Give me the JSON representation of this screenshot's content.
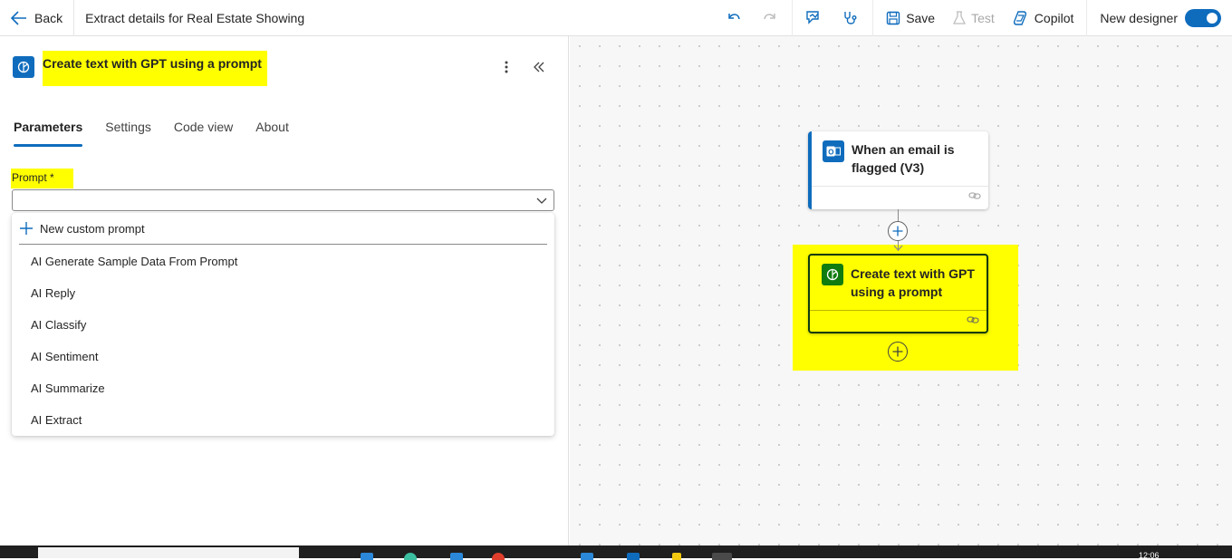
{
  "topbar": {
    "back_label": "Back",
    "flow_title": "Extract details for Real Estate Showing",
    "save_label": "Save",
    "test_label": "Test",
    "copilot_label": "Copilot",
    "new_designer_label": "New designer",
    "new_designer_on": true
  },
  "panel": {
    "title": "Create text with GPT using a prompt",
    "tabs": [
      {
        "label": "Parameters",
        "active": true
      },
      {
        "label": "Settings",
        "active": false
      },
      {
        "label": "Code view",
        "active": false
      },
      {
        "label": "About",
        "active": false
      }
    ],
    "prompt_label": "Prompt *",
    "prompt_value": "",
    "dropdown": {
      "new_label": "New custom prompt",
      "items": [
        "AI Generate Sample Data From Prompt",
        "AI Reply",
        "AI Classify",
        "AI Sentiment",
        "AI Summarize",
        "AI Extract"
      ]
    }
  },
  "canvas": {
    "nodes": [
      {
        "title": "When an email is flagged (V3)",
        "icon": "outlook-icon",
        "color": "#0f6cbd"
      },
      {
        "title": "Create text with GPT using a prompt",
        "icon": "ai-builder-icon",
        "color": "#107c10"
      }
    ]
  },
  "taskbar": {
    "clock": "12:06"
  },
  "colors": {
    "accent": "#0f6cbd",
    "highlight": "#ffff00",
    "ai_green": "#107c10"
  }
}
